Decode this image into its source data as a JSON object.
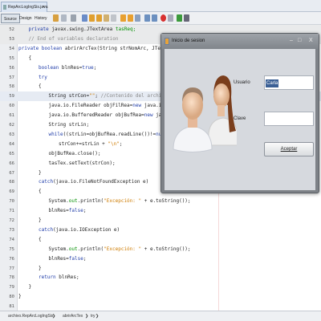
{
  "editor_tab": {
    "filename": "RepArcLogIngSis.java",
    "close": "×"
  },
  "toolbar": {
    "source": "Source",
    "design": "Design",
    "history": "History"
  },
  "code_lines": [
    {
      "n": "52",
      "i": 1,
      "bg": "gray",
      "t": [
        [
          "kw",
          "private "
        ],
        [
          "",
          "javax.swing.JTextArea "
        ],
        [
          "fd",
          "tasReq;"
        ]
      ]
    },
    {
      "n": "53",
      "i": 1,
      "bg": "gray",
      "t": [
        [
          "cm",
          "// End of variables declaration"
        ]
      ]
    },
    {
      "n": "54",
      "i": 0,
      "t": [
        [
          "kw",
          "private boolean "
        ],
        [
          "",
          "abrirArcTex(String strNomArc, JTextArea t"
        ]
      ]
    },
    {
      "n": "55",
      "i": 1,
      "t": [
        [
          "",
          "{"
        ]
      ]
    },
    {
      "n": "56",
      "i": 2,
      "t": [
        [
          "kw",
          "boolean "
        ],
        [
          "",
          "blnRes="
        ],
        [
          "kw",
          "true"
        ],
        [
          "",
          ";"
        ]
      ]
    },
    {
      "n": "57",
      "i": 2,
      "t": [
        [
          "kw",
          "try"
        ]
      ]
    },
    {
      "n": "58",
      "i": 2,
      "t": [
        [
          "",
          "{"
        ]
      ]
    },
    {
      "n": "59",
      "i": 3,
      "bg": "hl",
      "t": [
        [
          "",
          "String strCon="
        ],
        [
          "st",
          "\"\""
        ],
        [
          "",
          "; "
        ],
        [
          "cm",
          "//Contenido del archivo."
        ]
      ]
    },
    {
      "n": "60",
      "i": 3,
      "t": [
        [
          "",
          "java.io.FileReader objFilRea="
        ],
        [
          "kw",
          "new "
        ],
        [
          "",
          "java.io.File"
        ]
      ]
    },
    {
      "n": "61",
      "i": 3,
      "t": [
        [
          "",
          "java.io.BufferedReader objBufRea="
        ],
        [
          "kw",
          "new "
        ],
        [
          "",
          "java.io."
        ]
      ]
    },
    {
      "n": "62",
      "i": 3,
      "t": [
        [
          "",
          "String strLin;"
        ]
      ]
    },
    {
      "n": "63",
      "i": 3,
      "t": [
        [
          "kw",
          "while"
        ],
        [
          "",
          "((strLin=objBufRea.readLine())!="
        ],
        [
          "kw",
          "null"
        ],
        [
          "",
          ")"
        ]
      ]
    },
    {
      "n": "64",
      "i": 4,
      "t": [
        [
          "",
          "strCon+=strLin + "
        ],
        [
          "st",
          "\"\\n\""
        ],
        [
          "",
          ";"
        ]
      ]
    },
    {
      "n": "65",
      "i": 3,
      "t": [
        [
          "",
          "objBufRea.close();"
        ]
      ]
    },
    {
      "n": "66",
      "i": 3,
      "t": [
        [
          "",
          "tasTex.setText(strCon);"
        ]
      ]
    },
    {
      "n": "67",
      "i": 2,
      "t": [
        [
          "",
          "}"
        ]
      ]
    },
    {
      "n": "68",
      "i": 2,
      "t": [
        [
          "kw",
          "catch"
        ],
        [
          "",
          "(java.io.FileNotFoundException e)"
        ]
      ]
    },
    {
      "n": "69",
      "i": 2,
      "t": [
        [
          "",
          "{"
        ]
      ]
    },
    {
      "n": "70",
      "i": 3,
      "t": [
        [
          "",
          "System."
        ],
        [
          "fd",
          "out"
        ],
        [
          "",
          ".println("
        ],
        [
          "st",
          "\"Excepción: \""
        ],
        [
          "",
          " + e.toString());"
        ]
      ]
    },
    {
      "n": "71",
      "i": 3,
      "t": [
        [
          "",
          "blnRes="
        ],
        [
          "kw",
          "false"
        ],
        [
          "",
          ";"
        ]
      ]
    },
    {
      "n": "72",
      "i": 2,
      "t": [
        [
          "",
          "}"
        ]
      ]
    },
    {
      "n": "73",
      "i": 2,
      "t": [
        [
          "kw",
          "catch"
        ],
        [
          "",
          "(java.io.IOException e)"
        ]
      ]
    },
    {
      "n": "74",
      "i": 2,
      "t": [
        [
          "",
          "{"
        ]
      ]
    },
    {
      "n": "75",
      "i": 3,
      "t": [
        [
          "",
          "System."
        ],
        [
          "fd",
          "out"
        ],
        [
          "",
          ".println("
        ],
        [
          "st",
          "\"Excepción: \""
        ],
        [
          "",
          " + e.toString());"
        ]
      ]
    },
    {
      "n": "76",
      "i": 3,
      "t": [
        [
          "",
          "blnRes="
        ],
        [
          "kw",
          "false"
        ],
        [
          "",
          ";"
        ]
      ]
    },
    {
      "n": "77",
      "i": 2,
      "t": [
        [
          "",
          "}"
        ]
      ]
    },
    {
      "n": "78",
      "i": 2,
      "t": [
        [
          "kw",
          "return "
        ],
        [
          "",
          "blnRes;"
        ]
      ]
    },
    {
      "n": "79",
      "i": 1,
      "t": [
        [
          "",
          "}"
        ]
      ]
    },
    {
      "n": "80",
      "i": 0,
      "t": [
        [
          "",
          "}"
        ]
      ]
    },
    {
      "n": "81",
      "i": 0,
      "t": []
    }
  ],
  "breadcrumb": {
    "class": "archivo.RepArcLogIngSis",
    "method": "abrirArcTex",
    "block": "try"
  },
  "dialog": {
    "title": "Inicio de sesion",
    "minimize": "‒",
    "maximize": "□",
    "close": "X",
    "user_label": "Usuario",
    "user_value": "Carla",
    "pass_label": "Clave",
    "pass_value": "",
    "accept": "Aceptar"
  }
}
